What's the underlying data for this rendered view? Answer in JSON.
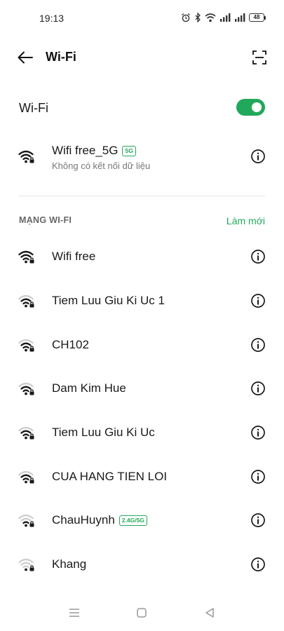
{
  "status_bar": {
    "time": "19:13",
    "battery": "48"
  },
  "app_bar": {
    "title": "Wi-Fi"
  },
  "toggle": {
    "label": "Wi-Fi",
    "state": "on"
  },
  "connected": {
    "name": "Wifi free_5G",
    "band": "5G",
    "status": "Không có kết nối dữ liệu",
    "signal": 4,
    "locked": true
  },
  "section": {
    "header": "MẠNG WI-FI",
    "refresh": "Làm mới"
  },
  "networks": [
    {
      "name": "Wifi free",
      "band": "",
      "signal": 4,
      "locked": true
    },
    {
      "name": "Tiem Luu Giu Ki Uc 1",
      "band": "",
      "signal": 3,
      "locked": true
    },
    {
      "name": "CH102",
      "band": "",
      "signal": 3,
      "locked": true
    },
    {
      "name": "Dam Kim Hue",
      "band": "",
      "signal": 3,
      "locked": true
    },
    {
      "name": "Tiem Luu Giu Ki Uc",
      "band": "",
      "signal": 3,
      "locked": true
    },
    {
      "name": "CUA HANG TIEN LOI",
      "band": "",
      "signal": 3,
      "locked": true
    },
    {
      "name": "ChauHuynh",
      "band": "2.4G/5G",
      "signal": 2,
      "locked": true
    },
    {
      "name": "Khang",
      "band": "",
      "signal": 1,
      "locked": true
    }
  ],
  "colors": {
    "accent": "#22a85a",
    "text": "#1a1a1a",
    "secondary": "#777777"
  }
}
